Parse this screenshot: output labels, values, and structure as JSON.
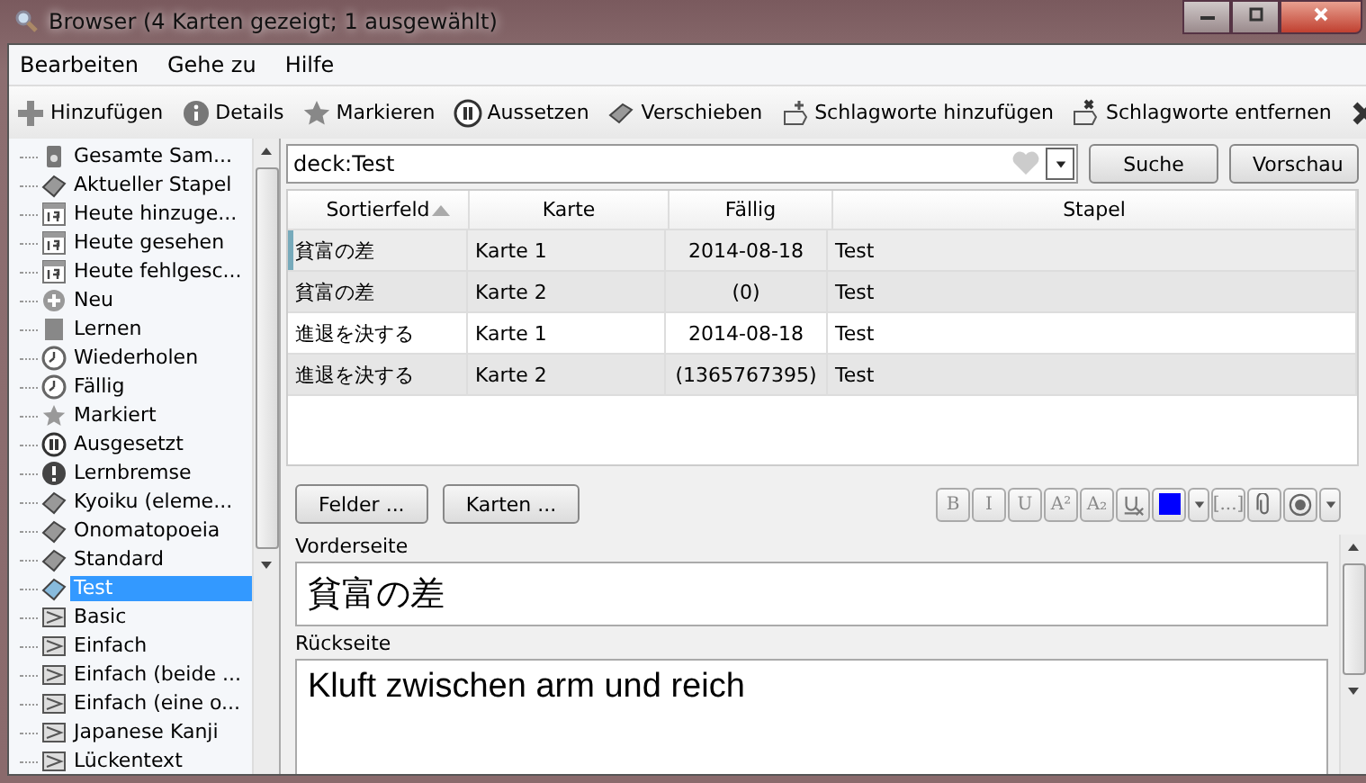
{
  "window": {
    "title": "Browser (4 Karten gezeigt; 1 ausgewählt)"
  },
  "menu": [
    "Bearbeiten",
    "Gehe zu",
    "Hilfe"
  ],
  "toolbar": [
    {
      "kind": "add",
      "label": "Hinzufügen"
    },
    {
      "kind": "info",
      "label": "Details"
    },
    {
      "kind": "mark",
      "label": "Markieren"
    },
    {
      "kind": "suspend",
      "label": "Aussetzen"
    },
    {
      "kind": "move",
      "label": "Verschieben"
    },
    {
      "kind": "tag-add",
      "label": "Schlagworte hinzufügen"
    },
    {
      "kind": "tag-remove",
      "label": "Schlagworte entfernen"
    },
    {
      "kind": "delete"
    }
  ],
  "sidebar": {
    "items": [
      {
        "kind": "collection",
        "label": "Gesamte Sam...",
        "selected": false
      },
      {
        "kind": "deck",
        "label": "Aktueller Stapel",
        "selected": false
      },
      {
        "kind": "today",
        "label": "Heute hinzuge...",
        "selected": false
      },
      {
        "kind": "today",
        "label": "Heute gesehen",
        "selected": false
      },
      {
        "kind": "today",
        "label": "Heute fehlgesc...",
        "selected": false
      },
      {
        "kind": "new",
        "label": "Neu",
        "selected": false
      },
      {
        "kind": "learn",
        "label": "Lernen",
        "selected": false
      },
      {
        "kind": "due",
        "label": "Wiederholen",
        "selected": false
      },
      {
        "kind": "due",
        "label": "Fällig",
        "selected": false
      },
      {
        "kind": "marked",
        "label": "Markiert",
        "selected": false
      },
      {
        "kind": "suspended",
        "label": "Ausgesetzt",
        "selected": false
      },
      {
        "kind": "leech",
        "label": "Lernbremse",
        "selected": false
      },
      {
        "kind": "deck",
        "label": "Kyoiku (eleme...",
        "selected": false
      },
      {
        "kind": "deck",
        "label": "Onomatopoeia",
        "selected": false
      },
      {
        "kind": "deck",
        "label": "Standard",
        "selected": false
      },
      {
        "kind": "deck",
        "label": "Test",
        "selected": true
      },
      {
        "kind": "notetype",
        "label": "Basic",
        "selected": false
      },
      {
        "kind": "notetype",
        "label": "Einfach",
        "selected": false
      },
      {
        "kind": "notetype",
        "label": "Einfach (beide ...",
        "selected": false
      },
      {
        "kind": "notetype",
        "label": "Einfach (eine o...",
        "selected": false
      },
      {
        "kind": "notetype",
        "label": "Japanese Kanji",
        "selected": false
      },
      {
        "kind": "notetype",
        "label": "Lückentext",
        "selected": false
      }
    ]
  },
  "search": {
    "value": "deck:Test",
    "buttons": [
      "Suche",
      "Vorschau"
    ]
  },
  "table": {
    "columns": [
      "Sortierfeld",
      "Karte",
      "Fällig",
      "Stapel"
    ],
    "rows": [
      {
        "cells": [
          "貧富の差",
          "Karte 1",
          "2014-08-18",
          "Test"
        ],
        "selected": true
      },
      {
        "cells": [
          "貧富の差",
          "Karte 2",
          "(0)",
          "Test"
        ],
        "selected": false
      },
      {
        "cells": [
          "進退を決する",
          "Karte 1",
          "2014-08-18",
          "Test"
        ],
        "selected": false
      },
      {
        "cells": [
          "進退を決する",
          "Karte 2",
          "(1365767395)",
          "Test"
        ],
        "selected": false
      }
    ]
  },
  "editor": {
    "buttons": [
      "Felder ...",
      "Karten ..."
    ],
    "format": [
      {
        "kind": "text",
        "label": "B"
      },
      {
        "kind": "text",
        "label": "I"
      },
      {
        "kind": "text",
        "label": "U"
      },
      {
        "kind": "text",
        "label": "A²"
      },
      {
        "kind": "text",
        "label": "A₂"
      },
      {
        "kind": "clear"
      },
      {
        "kind": "color",
        "color": "#0000ff"
      },
      {
        "kind": "dropdown"
      },
      {
        "kind": "text",
        "label": "[...]"
      },
      {
        "kind": "attach"
      },
      {
        "kind": "record"
      },
      {
        "kind": "dropdown"
      }
    ],
    "fields": [
      {
        "label": "Vorderseite",
        "value": "貧富の差"
      },
      {
        "label": "Rückseite",
        "value": "Kluft zwischen arm und reich"
      }
    ]
  }
}
